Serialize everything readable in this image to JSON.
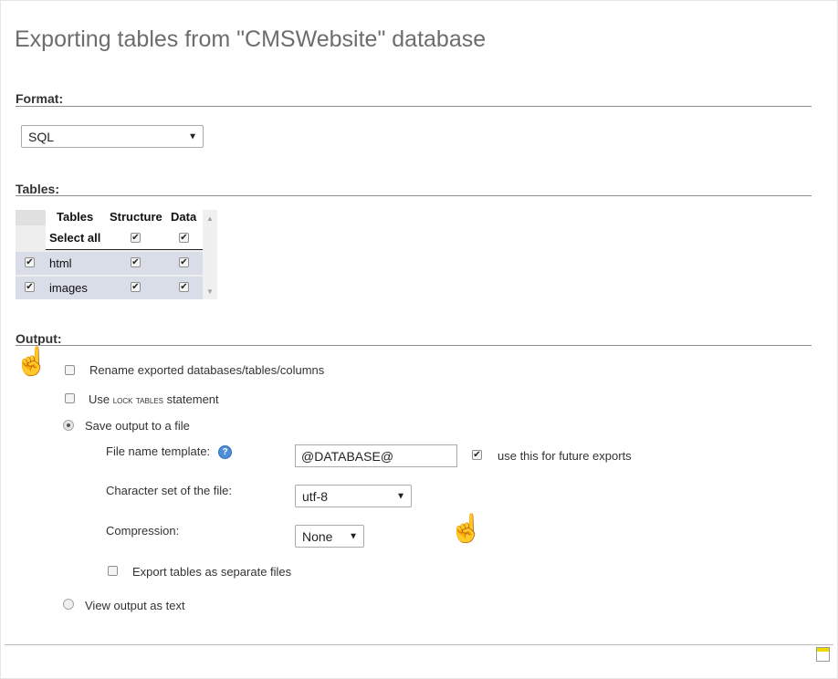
{
  "page": {
    "title": "Exporting tables from \"CMSWebsite\" database"
  },
  "format": {
    "heading": "Format:",
    "selected": "SQL"
  },
  "tables": {
    "heading": "Tables:",
    "columns": [
      "Tables",
      "Structure",
      "Data"
    ],
    "select_all_label": "Select all",
    "rows": [
      {
        "name": "html"
      },
      {
        "name": "images"
      }
    ]
  },
  "output": {
    "heading": "Output:",
    "rename_label": "Rename exported databases/tables/columns",
    "lock_prefix": "Use ",
    "lock_keyword": "lock tables",
    "lock_suffix": " statement",
    "save_file_label": "Save output to a file",
    "file_name_template_label": "File name template:",
    "file_name_template_value": "@DATABASE@",
    "future_exports_label": "use this for future exports",
    "charset_label": "Character set of the file:",
    "charset_value": "utf-8",
    "compression_label": "Compression:",
    "compression_value": "None",
    "separate_files_label": "Export tables as separate files",
    "view_text_label": "View output as text"
  },
  "icons": {
    "help": "question-icon",
    "dropdown": "triangle-down-icon",
    "cursor": "hand-pointer-icon"
  },
  "colors": {
    "row_highlight": "#d9dde8",
    "help_icon": "#4c8ed8"
  }
}
